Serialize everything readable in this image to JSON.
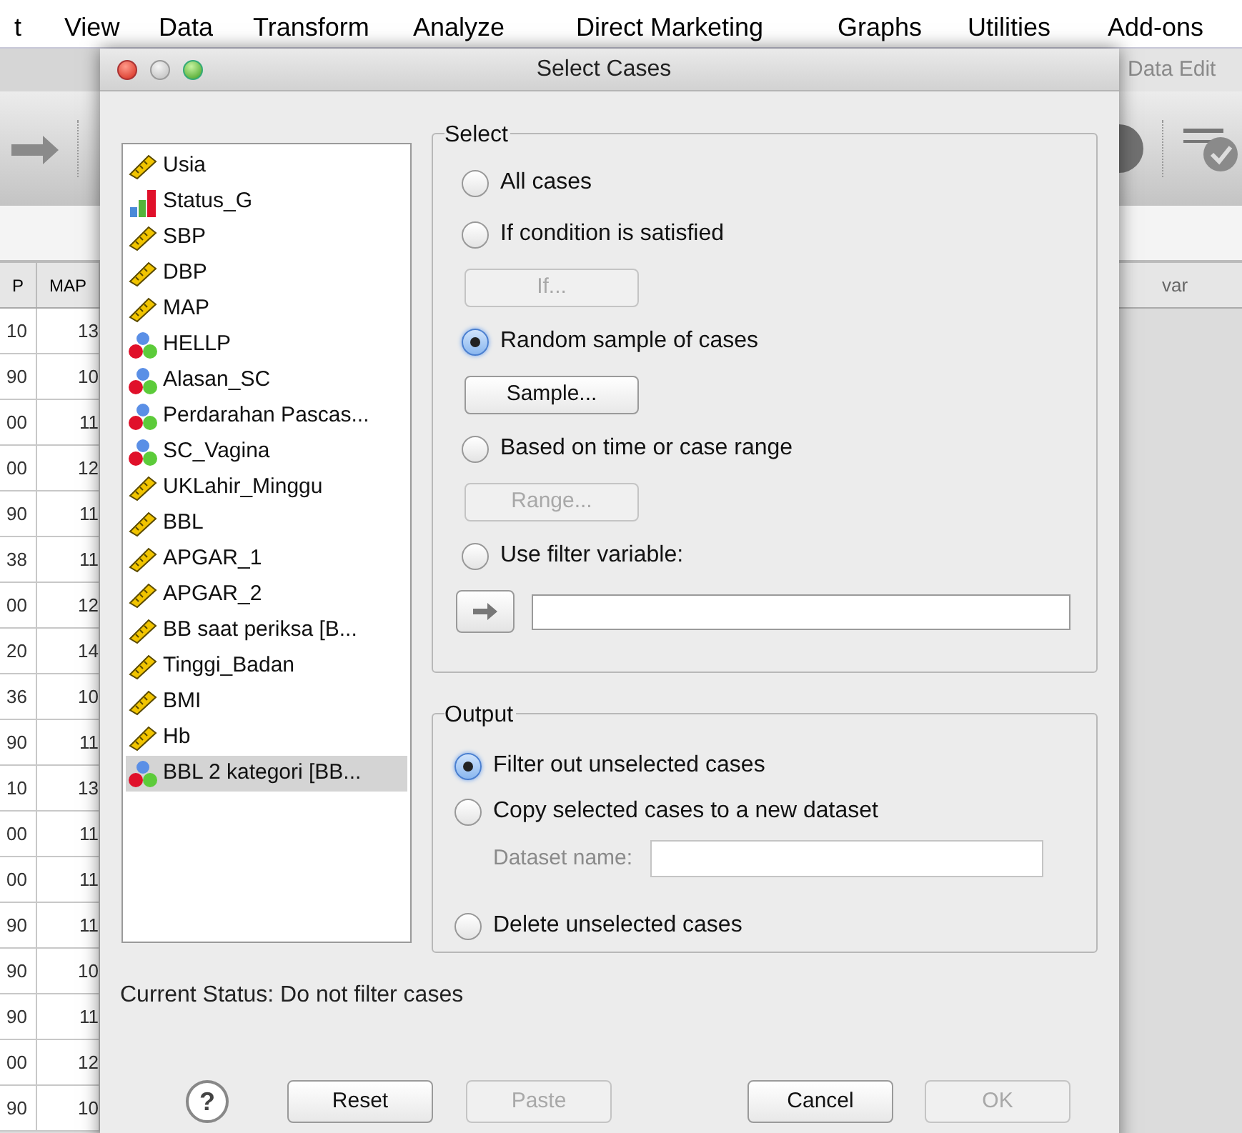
{
  "menu_bar": [
    "t",
    "View",
    "Data",
    "Transform",
    "Analyze",
    "Direct Marketing",
    "Graphs",
    "Utilities",
    "Add-ons"
  ],
  "data_view_left": {
    "columns": [
      "P",
      "MAP"
    ],
    "rows": [
      [
        "10",
        "13"
      ],
      [
        "90",
        "10"
      ],
      [
        "00",
        "11"
      ],
      [
        "00",
        "12"
      ],
      [
        "90",
        "11"
      ],
      [
        "38",
        "11"
      ],
      [
        "00",
        "12"
      ],
      [
        "20",
        "14"
      ],
      [
        "36",
        "10"
      ],
      [
        "90",
        "11"
      ],
      [
        "10",
        "13"
      ],
      [
        "00",
        "11"
      ],
      [
        "00",
        "11"
      ],
      [
        "90",
        "11"
      ],
      [
        "90",
        "10"
      ],
      [
        "90",
        "11"
      ],
      [
        "00",
        "12"
      ],
      [
        "90",
        "10"
      ]
    ]
  },
  "data_view_right": {
    "title": "Data Edit",
    "column": "var"
  },
  "dialog": {
    "title": "Select Cases",
    "variables": [
      {
        "name": "Usia",
        "kind": "scale",
        "selected": false
      },
      {
        "name": "Status_G",
        "kind": "ordinal",
        "selected": false
      },
      {
        "name": "SBP",
        "kind": "scale",
        "selected": false
      },
      {
        "name": "DBP",
        "kind": "scale",
        "selected": false
      },
      {
        "name": "MAP",
        "kind": "scale",
        "selected": false
      },
      {
        "name": "HELLP",
        "kind": "nominal",
        "selected": false
      },
      {
        "name": "Alasan_SC",
        "kind": "nominal",
        "selected": false
      },
      {
        "name": "Perdarahan Pascas...",
        "kind": "nominal",
        "selected": false
      },
      {
        "name": "SC_Vagina",
        "kind": "nominal",
        "selected": false
      },
      {
        "name": "UKLahir_Minggu",
        "kind": "scale",
        "selected": false
      },
      {
        "name": "BBL",
        "kind": "scale",
        "selected": false
      },
      {
        "name": "APGAR_1",
        "kind": "scale",
        "selected": false
      },
      {
        "name": "APGAR_2",
        "kind": "scale",
        "selected": false
      },
      {
        "name": "BB saat periksa [B...",
        "kind": "scale",
        "selected": false
      },
      {
        "name": "Tinggi_Badan",
        "kind": "scale",
        "selected": false
      },
      {
        "name": "BMI",
        "kind": "scale",
        "selected": false
      },
      {
        "name": "Hb",
        "kind": "scale",
        "selected": false
      },
      {
        "name": "BBL 2 kategori [BB...",
        "kind": "nominal",
        "selected": true
      }
    ],
    "select": {
      "title": "Select",
      "options": [
        {
          "label": "All cases",
          "selected": false,
          "kind": "plain"
        },
        {
          "label": "If condition is satisfied",
          "selected": false,
          "kind": "button",
          "button": {
            "label": "If...",
            "disabled": true
          }
        },
        {
          "label": "Random sample of cases",
          "selected": true,
          "kind": "button",
          "button": {
            "label": "Sample...",
            "disabled": false
          }
        },
        {
          "label": "Based on time or case range",
          "selected": false,
          "kind": "button",
          "button": {
            "label": "Range...",
            "disabled": true
          }
        },
        {
          "label": "Use filter variable:",
          "selected": false,
          "kind": "filter"
        }
      ]
    },
    "output": {
      "title": "Output",
      "options": [
        {
          "label": "Filter out unselected cases",
          "selected": true,
          "kind": "plain"
        },
        {
          "label": "Copy selected cases to a new dataset",
          "selected": false,
          "kind": "dataset",
          "field_label": "Dataset name:"
        },
        {
          "label": "Delete unselected cases",
          "selected": false,
          "kind": "plain"
        }
      ]
    },
    "status": "Current Status: Do not filter cases",
    "help": "?",
    "buttons": [
      {
        "label": "Reset",
        "disabled": false
      },
      {
        "label": "Paste",
        "disabled": true
      },
      {
        "label": "Cancel",
        "disabled": false
      },
      {
        "label": "OK",
        "disabled": true
      }
    ]
  }
}
